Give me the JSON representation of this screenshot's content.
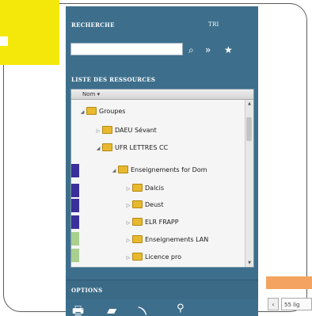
{
  "search_section": {
    "title": "RECHERCHE",
    "tab_label": "Tri",
    "input_value": "",
    "input_placeholder": ""
  },
  "resources_section": {
    "title": "LISTE DES RESSOURCES",
    "column_header": "Nom"
  },
  "tree": [
    {
      "label": "Groupes",
      "expanded": true,
      "strip_color": ""
    },
    {
      "label": "DAEU Sévant",
      "expanded": false,
      "strip_color": ""
    },
    {
      "label": "UFR LETTRES CC",
      "expanded": true,
      "strip_color": ""
    },
    {
      "label": "Enseignements for Dom",
      "expanded": true,
      "strip_color": "#3b2f9a"
    },
    {
      "label": "Dalcis",
      "expanded": false,
      "strip_color": "#3b2f9a"
    },
    {
      "label": "Deust",
      "expanded": false,
      "strip_color": "#3b2f9a"
    },
    {
      "label": "ELR FRAPP",
      "expanded": false,
      "strip_color": "#3b2f9a"
    },
    {
      "label": "Enseignements LAN",
      "expanded": false,
      "strip_color": "#a9d08e"
    },
    {
      "label": "Licence pro",
      "expanded": false,
      "strip_color": "#a9d08e"
    }
  ],
  "options_section": {
    "title": "OPTIONS"
  },
  "pager": {
    "prev_label": "‹",
    "page_text": "55 lig"
  },
  "colors": {
    "panel": "#3d6f8c",
    "yellow": "#f4e80a",
    "orange": "#f4a460"
  }
}
